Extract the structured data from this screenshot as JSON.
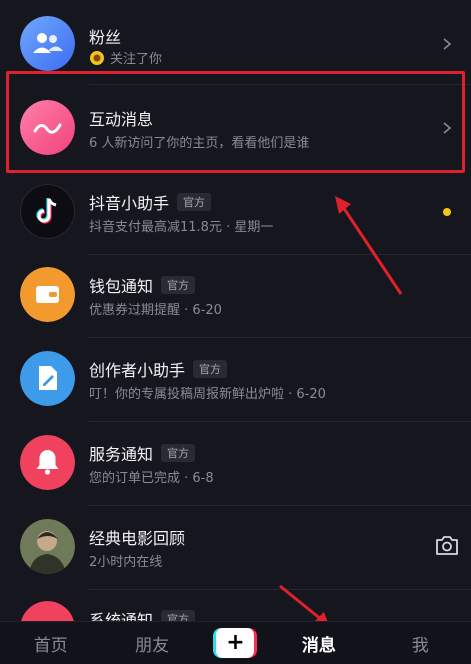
{
  "rows": [
    {
      "title": "粉丝",
      "sub": "关注了你",
      "tag": ""
    },
    {
      "title": "互动消息",
      "sub": "6 人新访问了你的主页，看看他们是谁",
      "tag": ""
    },
    {
      "title": "抖音小助手",
      "sub": "抖音支付最高减11.8元 · 星期一",
      "tag": "官方"
    },
    {
      "title": "钱包通知",
      "sub": "优惠券过期提醒 · 6-20",
      "tag": "官方"
    },
    {
      "title": "创作者小助手",
      "sub": "叮！你的专属投稿周报新鲜出炉啦 · 6-20",
      "tag": "官方"
    },
    {
      "title": "服务通知",
      "sub": "您的订单已完成 · 6-8",
      "tag": "官方"
    },
    {
      "title": "经典电影回顾",
      "sub": "2小时内在线",
      "tag": ""
    },
    {
      "title": "系统通知",
      "sub": "",
      "tag": "官方"
    }
  ],
  "tabbar": {
    "home": "首页",
    "friends": "朋友",
    "plus": "+",
    "messages": "消息",
    "me": "我"
  },
  "colors": {
    "background": "#16161f",
    "highlight_box": "#e0202c",
    "annotation_arrow": "#e0202c",
    "unread_dot": "#f5c518"
  },
  "icons": [
    "fans-avatar-icon",
    "interaction-avatar-icon",
    "douyin-logo-icon",
    "wallet-icon",
    "edit-icon",
    "bell-icon",
    "camera-icon",
    "chevron-right-icon",
    "sunflower-icon"
  ]
}
